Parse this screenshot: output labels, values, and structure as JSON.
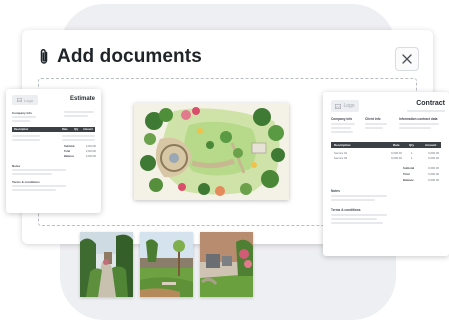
{
  "modal": {
    "title": "Add documents",
    "title_icon": "paperclip-icon",
    "close_icon": "close-icon"
  },
  "estimate_doc": {
    "logo_label": "Logo",
    "title": "Estimate",
    "company_label": "Company info",
    "table_headers": [
      "Description",
      "Rate",
      "Qty",
      "Amount"
    ],
    "totals": [
      {
        "label": "Subtotal",
        "value": "0,000.00"
      },
      {
        "label": "Total",
        "value": "0,000.00"
      },
      {
        "label": "Balance",
        "value": "0,000.00"
      }
    ],
    "notes_label": "Notes",
    "terms_label": "Terms & conditions"
  },
  "contract_doc": {
    "logo_label": "Logo",
    "title": "Contract",
    "col_labels": [
      "Company info",
      "Client info",
      "Information contract data"
    ],
    "table_headers": [
      "Description",
      "Rate",
      "Qty",
      "Amount"
    ],
    "rows": [
      {
        "description": "Service #1",
        "rate": "0,000.00",
        "qty": "1",
        "amount": "0,000.00"
      },
      {
        "description": "Service #2",
        "rate": "0,000.00",
        "qty": "1",
        "amount": "0,000.00"
      }
    ],
    "totals": [
      {
        "label": "Subtotal",
        "value": "0,000.00"
      },
      {
        "label": "Total",
        "value": "0,000.00"
      },
      {
        "label": "Balance",
        "value": "0,000.00"
      }
    ],
    "notes_label": "Notes",
    "terms_label": "Terms & conditions"
  },
  "photos": [
    "garden-path-photo",
    "garden-lawn-photo",
    "garden-patio-photo"
  ]
}
